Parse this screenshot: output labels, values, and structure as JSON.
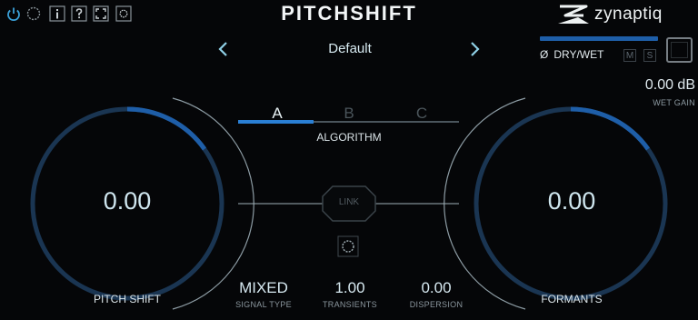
{
  "header": {
    "title": "PITCHSHIFT",
    "logo_text": "zynaptiq",
    "toolbar_icons": [
      "power-icon",
      "settings-ring-icon",
      "info-icon",
      "help-icon",
      "resize-icon",
      "gear-icon"
    ]
  },
  "preset": {
    "name": "Default"
  },
  "mix": {
    "drywet_label": "DRY/WET",
    "phase_symbol": "Ø",
    "m_label": "M",
    "s_label": "S",
    "drywet_level": 1.0,
    "wet_gain_value": "0.00 dB",
    "wet_gain_label": "WET GAIN"
  },
  "algorithm": {
    "label": "ALGORITHM",
    "options": [
      "A",
      "B",
      "C"
    ],
    "selected": "A"
  },
  "pitch_shift": {
    "value": "0.00",
    "label": "PITCH SHIFT"
  },
  "formants": {
    "value": "0.00",
    "label": "FORMANTS"
  },
  "link": {
    "label": "LINK"
  },
  "bottom": {
    "signal_type_value": "MIXED",
    "signal_type_label": "SIGNAL TYPE",
    "transients_value": "1.00",
    "transients_label": "TRANSIENTS",
    "dispersion_value": "0.00",
    "dispersion_label": "DISPERSION"
  },
  "colors": {
    "accent": "#1e5ea8",
    "ring": "#1b3f66",
    "text": "#dfe7ea"
  }
}
